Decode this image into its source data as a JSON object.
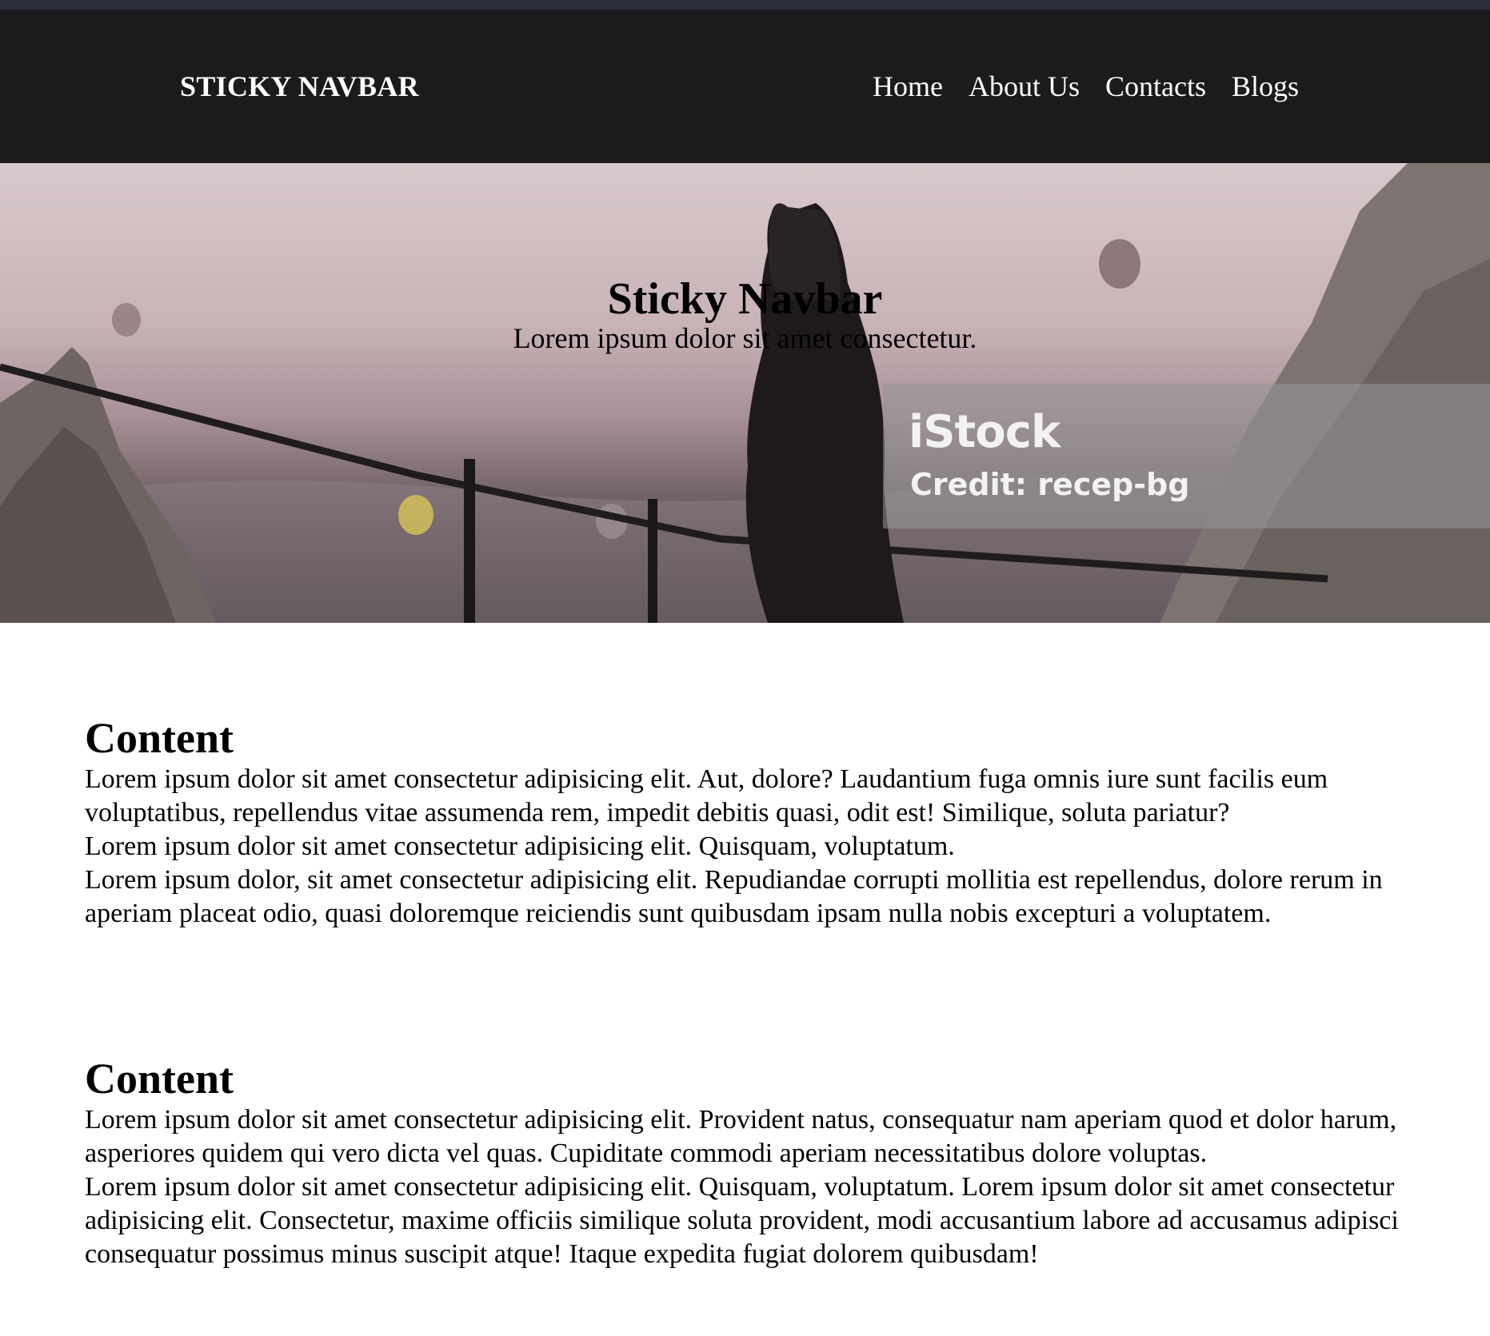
{
  "navbar": {
    "brand": "STICKY NAVBAR",
    "links": [
      "Home",
      "About Us",
      "Contacts",
      "Blogs"
    ]
  },
  "hero": {
    "title": "Sticky Navbar",
    "subtitle": "Lorem ipsum dolor sit amet consectetur.",
    "watermark": {
      "logo": "iStock",
      "credit": "Credit: recep-bg"
    }
  },
  "sections": [
    {
      "heading": "Content",
      "lines": [
        "Lorem ipsum dolor sit amet consectetur adipisicing elit. Aut, dolore? Laudantium fuga omnis iure sunt facilis eum voluptatibus, repellendus vitae assumenda rem, impedit debitis quasi, odit est! Similique, soluta pariatur?",
        "Lorem ipsum dolor sit amet consectetur adipisicing elit. Quisquam, voluptatum.",
        "Lorem ipsum dolor, sit amet consectetur adipisicing elit. Repudiandae corrupti mollitia est repellendus, dolore rerum in aperiam placeat odio, quasi doloremque reiciendis sunt quibusdam ipsam nulla nobis excepturi a voluptatem."
      ]
    },
    {
      "heading": "Content",
      "lines": [
        "Lorem ipsum dolor sit amet consectetur adipisicing elit. Provident natus, consequatur nam aperiam quod et dolor harum, asperiores quidem qui vero dicta vel quas. Cupiditate commodi aperiam necessitatibus dolore voluptas.",
        "Lorem ipsum dolor sit amet consectetur adipisicing elit. Quisquam, voluptatum. Lorem ipsum dolor sit amet consectetur adipisicing elit. Consectetur, maxime officiis similique soluta provident, modi accusantium labore ad accusamus adipisci consequatur possimus minus suscipit atque! Itaque expedita fugiat dolorem quibusdam!"
      ]
    }
  ]
}
